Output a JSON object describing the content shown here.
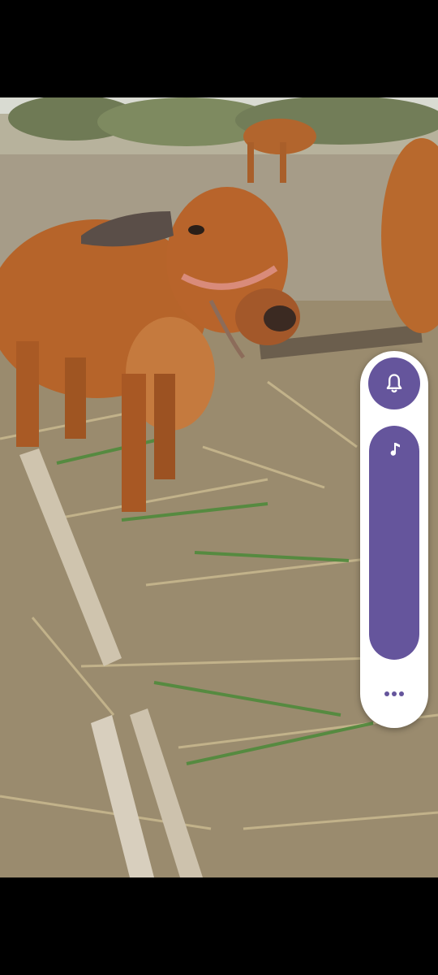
{
  "volume_panel": {
    "ringer_icon": "bell-icon",
    "media_icon": "music-note-icon",
    "more_icon": "more-horizontal-icon",
    "media_level": 1.0,
    "accent_color": "#65559c",
    "panel_color": "#ffffff"
  },
  "video": {
    "description_icon": "video-frame"
  }
}
